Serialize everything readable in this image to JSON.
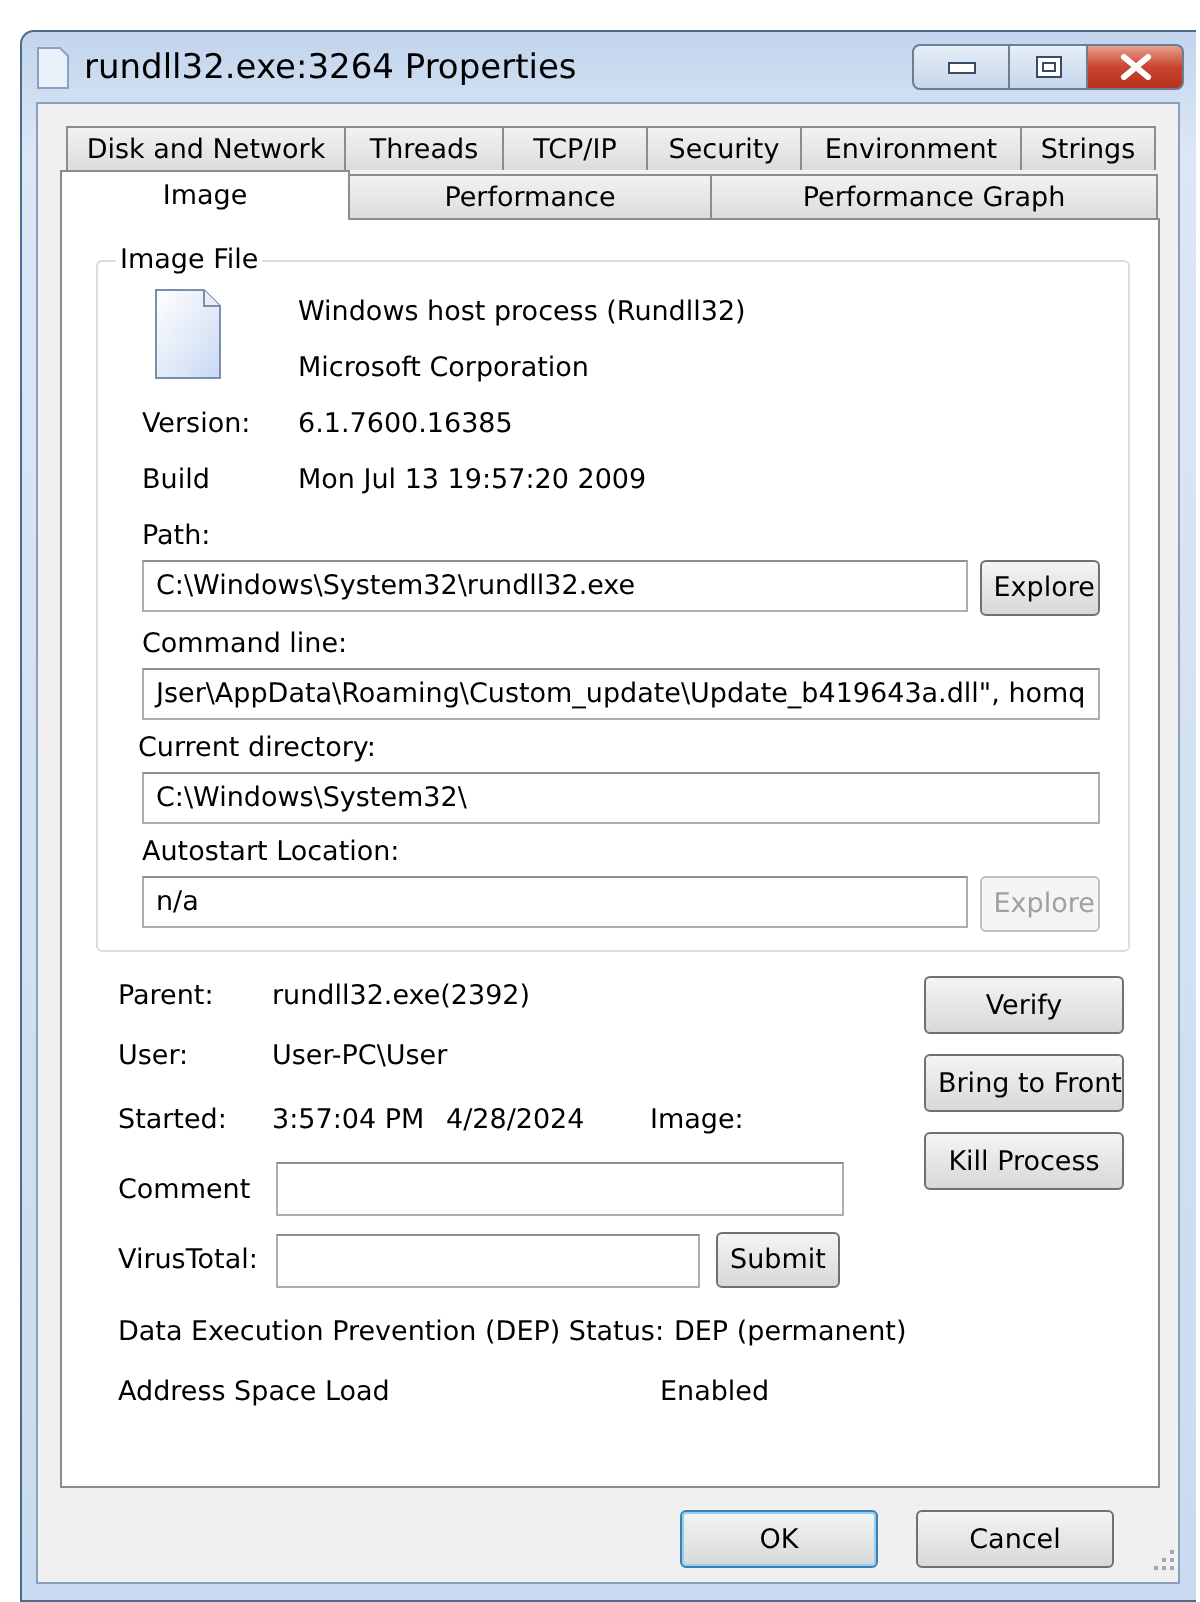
{
  "window": {
    "title": "rundll32.exe:3264 Properties"
  },
  "tab_rows": [
    {
      "tabs": [
        {
          "label": "Disk and Network",
          "selected": false
        },
        {
          "label": "Threads",
          "selected": false
        },
        {
          "label": "TCP/IP",
          "selected": false
        },
        {
          "label": "Security",
          "selected": false
        },
        {
          "label": "Environment",
          "selected": false
        },
        {
          "label": "Strings",
          "selected": false
        }
      ]
    },
    {
      "tabs": [
        {
          "label": "Image",
          "selected": true
        },
        {
          "label": "Performance",
          "selected": false
        },
        {
          "label": "Performance Graph",
          "selected": false
        }
      ]
    }
  ],
  "image_file": {
    "legend": "Image File",
    "description": "Windows host process (Rundll32)",
    "company": "Microsoft Corporation",
    "details": [
      {
        "label": "Version:",
        "value": "6.1.7600.16385"
      },
      {
        "label": "Build",
        "value": "Mon Jul 13 19:57:20 2009"
      }
    ],
    "fields": [
      {
        "label": "Path:",
        "value": "C:\\Windows\\System32\\rundll32.exe",
        "button": {
          "label": "Explore",
          "disabled": false
        }
      },
      {
        "label": "Command line:",
        "value": "Jser\\AppData\\Roaming\\Custom_update\\Update_b419643a.dll\", homq"
      },
      {
        "label": "Current directory:",
        "value": "C:\\Windows\\System32\\"
      },
      {
        "label": "Autostart Location:",
        "value": "n/a",
        "button": {
          "label": "Explore",
          "disabled": true
        }
      }
    ]
  },
  "process": {
    "info": [
      {
        "label": "Parent:",
        "value": "rundll32.exe(2392)"
      },
      {
        "label": "User:",
        "value": "User-PC\\User"
      }
    ],
    "started": {
      "label": "Started:",
      "time": "3:57:04 PM",
      "date": "4/28/2024",
      "image_label": "Image:"
    },
    "comment": {
      "label": "Comment"
    },
    "virustotal": {
      "label": "VirusTotal:",
      "button": "Submit"
    },
    "side_buttons": [
      "Verify",
      "Bring to Front",
      "Kill Process"
    ],
    "dep": {
      "label": "Data Execution Prevention (DEP) Status:",
      "value": "DEP (permanent)"
    },
    "aslr": {
      "label": "Address Space Load",
      "value": "Enabled"
    }
  },
  "buttons": [
    {
      "label": "OK",
      "default": true
    },
    {
      "label": "Cancel",
      "default": false
    }
  ]
}
